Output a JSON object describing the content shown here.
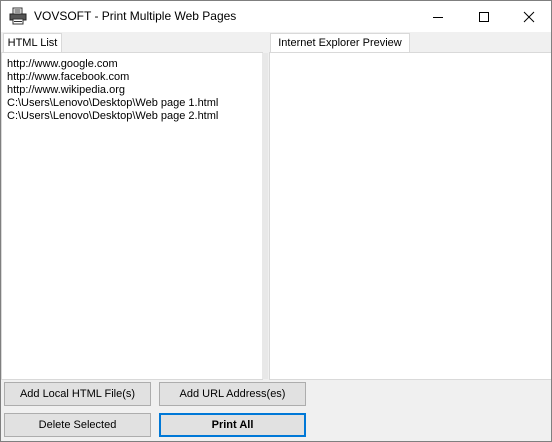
{
  "window": {
    "title": "VOVSOFT - Print Multiple Web Pages",
    "app_icon": "printer-icon",
    "controls": {
      "minimize_icon": "minimize-icon",
      "maximize_icon": "maximize-icon",
      "close_icon": "close-icon"
    }
  },
  "tabs": {
    "html_list": "HTML List",
    "ie_preview": "Internet Explorer Preview"
  },
  "html_list": {
    "items": [
      "http://www.google.com",
      "http://www.facebook.com",
      "http://www.wikipedia.org",
      "C:\\Users\\Lenovo\\Desktop\\Web page 1.html",
      "C:\\Users\\Lenovo\\Desktop\\Web page 2.html"
    ]
  },
  "buttons": {
    "add_local": "Add Local HTML File(s)",
    "add_url": "Add URL Address(es)",
    "delete_selected": "Delete Selected",
    "print_all": "Print All"
  },
  "colors": {
    "accent": "#0078d7",
    "window_bg": "#f0f0f0",
    "button_bg": "#e1e1e1"
  }
}
